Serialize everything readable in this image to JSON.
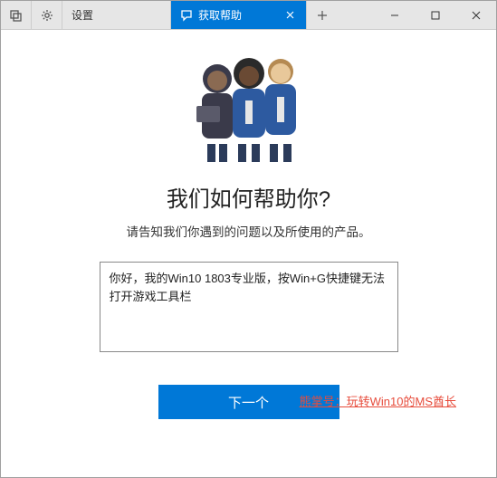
{
  "titlebar": {
    "tab_settings": {
      "label": "设置"
    },
    "tab_gethelp": {
      "label": "获取帮助"
    }
  },
  "main": {
    "heading": "我们如何帮助你?",
    "subheading": "请告知我们你遇到的问题以及所使用的产品。",
    "input_value": "你好，我的Win10 1803专业版，按Win+G快捷键无法打开游戏工具栏",
    "next_button": "下一个"
  },
  "watermark": "熊掌号：玩转Win10的MS酋长"
}
